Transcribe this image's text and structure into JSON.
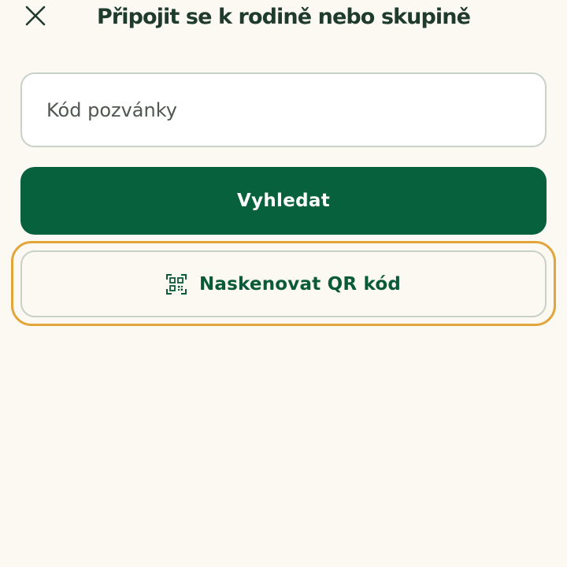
{
  "header": {
    "title": "Připojit se k rodině nebo skupině",
    "close_icon": "close-icon"
  },
  "form": {
    "invite_code": {
      "placeholder": "Kód pozvánky",
      "value": ""
    },
    "search_label": "Vyhledat",
    "scan_qr_label": "Naskenovat QR kód",
    "scan_qr_icon": "qr-code-icon"
  },
  "colors": {
    "background": "#fbf9f1",
    "primary_green": "#07613c",
    "title_text": "#1f3b2c",
    "input_border": "#c8d1c6",
    "focus_ring": "#e1a53a"
  }
}
